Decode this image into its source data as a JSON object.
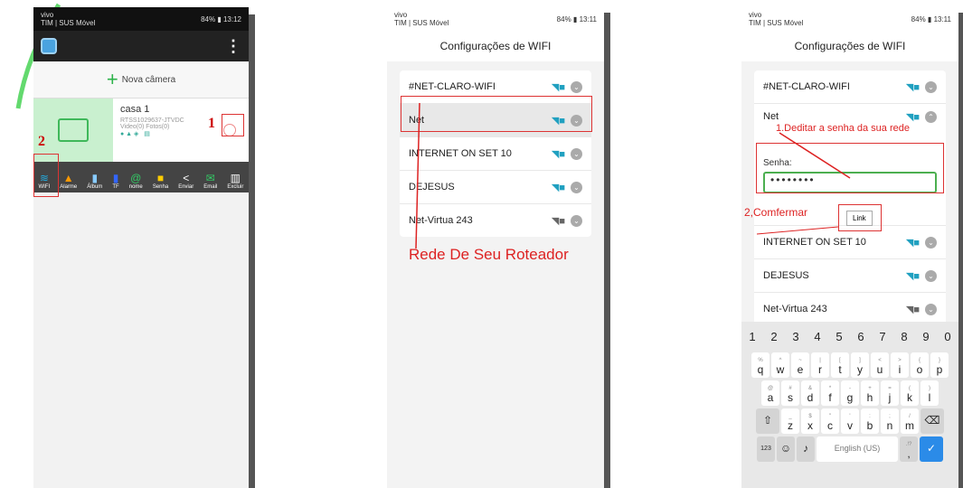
{
  "phone1": {
    "status_carrier_top": "vivo",
    "status_carrier_bottom": "TIM | SUS Móvel",
    "status_signal": "4G 4G",
    "status_battery": "84%",
    "status_time": "13:12",
    "menu_icon": "⋮",
    "new_camera_label": "Nova câmera",
    "device_name": "casa 1",
    "device_id": "RTSS1029637-JTVDC",
    "device_counts": "Video(0) Fotos(0)",
    "annotation_1": "1",
    "annotation_2": "2",
    "toolbar": [
      "WIFI",
      "Alarme",
      "Álbum",
      "TF",
      "nome",
      "Senha",
      "Enviar",
      "Email",
      "Excluir"
    ]
  },
  "phone2": {
    "status_carrier_top": "vivo",
    "status_carrier_bottom": "TIM | SUS Móvel",
    "status_battery": "84%",
    "status_time": "13:11",
    "title": "Configurações de WIFI",
    "networks": [
      "#NET-CLARO-WIFI",
      "Net",
      "INTERNET ON SET 10",
      "DEJESUS",
      "Net-Virtua 243"
    ],
    "annotation": "Rede De Seu Roteador"
  },
  "phone3": {
    "status_carrier_top": "vivo",
    "status_carrier_bottom": "TIM | SUS Móvel",
    "status_battery": "84%",
    "status_time": "13:11",
    "title": "Configurações de WIFI",
    "network_top": "#NET-CLARO-WIFI",
    "network_open": "Net",
    "annotation_1": "1.Deditar a senha da sua rede",
    "password_label": "Senha:",
    "password_value": "••••••••",
    "annotation_2": "2,Comfermar",
    "link_button": "Link",
    "networks_after": [
      "INTERNET ON SET 10",
      "DEJESUS",
      "Net-Virtua 243"
    ],
    "keyboard": {
      "numbers": [
        "1",
        "2",
        "3",
        "4",
        "5",
        "6",
        "7",
        "8",
        "9",
        "0"
      ],
      "row1": [
        "q",
        "w",
        "e",
        "r",
        "t",
        "y",
        "u",
        "i",
        "o",
        "p"
      ],
      "row1_hints": [
        "%",
        "^",
        "~",
        "|",
        "[",
        "]",
        "<",
        ">",
        "{",
        "}"
      ],
      "row2": [
        "a",
        "s",
        "d",
        "f",
        "g",
        "h",
        "j",
        "k",
        "l"
      ],
      "row2_hints": [
        "@",
        "#",
        "&",
        "*",
        "-",
        "+",
        "=",
        "(",
        ")"
      ],
      "row3": [
        "z",
        "x",
        "c",
        "v",
        "b",
        "n",
        "m"
      ],
      "row3_hints": [
        "_",
        "$",
        "\"",
        "'",
        ":",
        ";",
        "/"
      ],
      "sym_key": "123",
      "space_label": "English (US)",
      "punct_key": ",",
      "punct_hint": ".!?"
    }
  }
}
